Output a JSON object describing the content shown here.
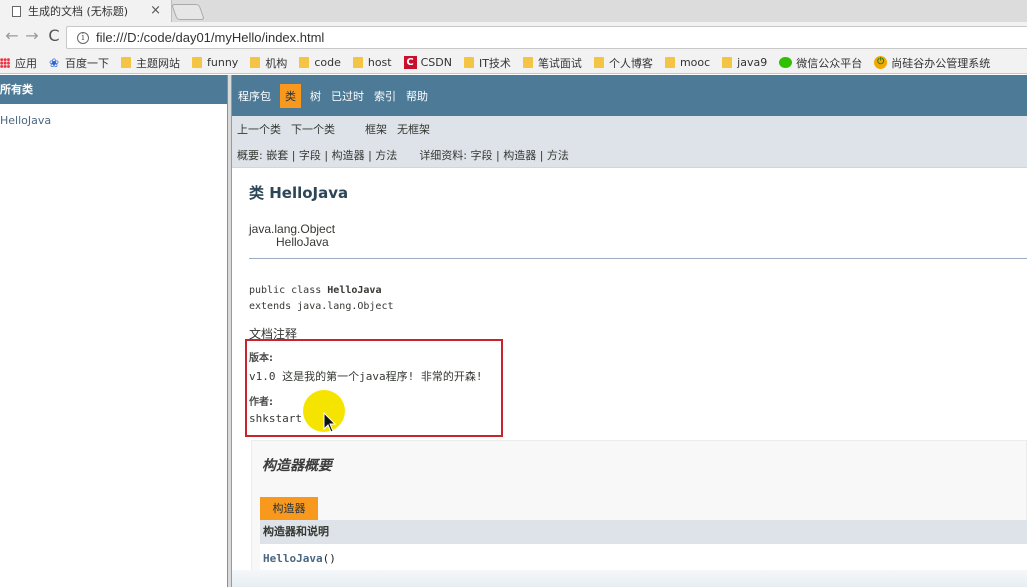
{
  "browser": {
    "tab_title": "生成的文档 (无标题)",
    "tab_close": "×",
    "back": "←",
    "forward": "→",
    "reload": "C",
    "info": "i",
    "url": "file:///D:/code/day01/myHello/index.html",
    "bookmarks": [
      {
        "label": "应用",
        "icon": "apps-icon"
      },
      {
        "label": "百度一下",
        "icon": "baidu-paw-icon"
      },
      {
        "label": "主题网站",
        "icon": "folder-icon"
      },
      {
        "label": "funny",
        "icon": "folder-icon"
      },
      {
        "label": "机构",
        "icon": "folder-icon"
      },
      {
        "label": "code",
        "icon": "folder-icon"
      },
      {
        "label": "host",
        "icon": "folder-icon"
      },
      {
        "label": "CSDN",
        "icon": "csdn-icon"
      },
      {
        "label": "IT技术",
        "icon": "folder-icon"
      },
      {
        "label": "笔试面试",
        "icon": "folder-icon"
      },
      {
        "label": "个人博客",
        "icon": "folder-icon"
      },
      {
        "label": "mooc",
        "icon": "folder-icon"
      },
      {
        "label": "java9",
        "icon": "folder-icon"
      },
      {
        "label": "微信公众平台",
        "icon": "wechat-icon"
      },
      {
        "label": "尚硅谷办公管理系统",
        "icon": "power-icon"
      }
    ]
  },
  "left_frame": {
    "header": "所有类",
    "classes": [
      "HelloJava"
    ]
  },
  "javadoc": {
    "topnav": [
      "程序包",
      "类",
      "树",
      "已过时",
      "索引",
      "帮助"
    ],
    "topnav_active": "类",
    "subnav": {
      "prev_class": "上一个类",
      "next_class": "下一个类",
      "frames": "框架",
      "no_frames": "无框架",
      "summary": "概要: 嵌套 | 字段 | 构造器 | 方法",
      "detail": "详细资料: 字段 | 构造器 | 方法"
    },
    "title": "类 HelloJava",
    "inheritance": [
      "java.lang.Object",
      "HelloJava"
    ],
    "signature": {
      "line1_prefix": "public class ",
      "line1_name": "HelloJava",
      "line2": "extends java.lang.Object"
    },
    "doc_comment": "文档注释",
    "tags": {
      "version_label": "版本:",
      "version_value": "v1.0 这是我的第一个java程序! 非常的开森!",
      "author_label": "作者:",
      "author_value": "shkstart"
    },
    "constructor_summary": {
      "title": "构造器概要",
      "caption": "构造器",
      "column_header": "构造器和说明",
      "rows": [
        {
          "name": "HelloJava",
          "suffix": "()"
        }
      ]
    }
  },
  "colors": {
    "nav_blue": "#4d7a97",
    "active_orange": "#f8981d",
    "subnav_gray": "#dee3e9",
    "highlight_red": "#c9242b",
    "cursor_yellow": "#f5e400"
  }
}
